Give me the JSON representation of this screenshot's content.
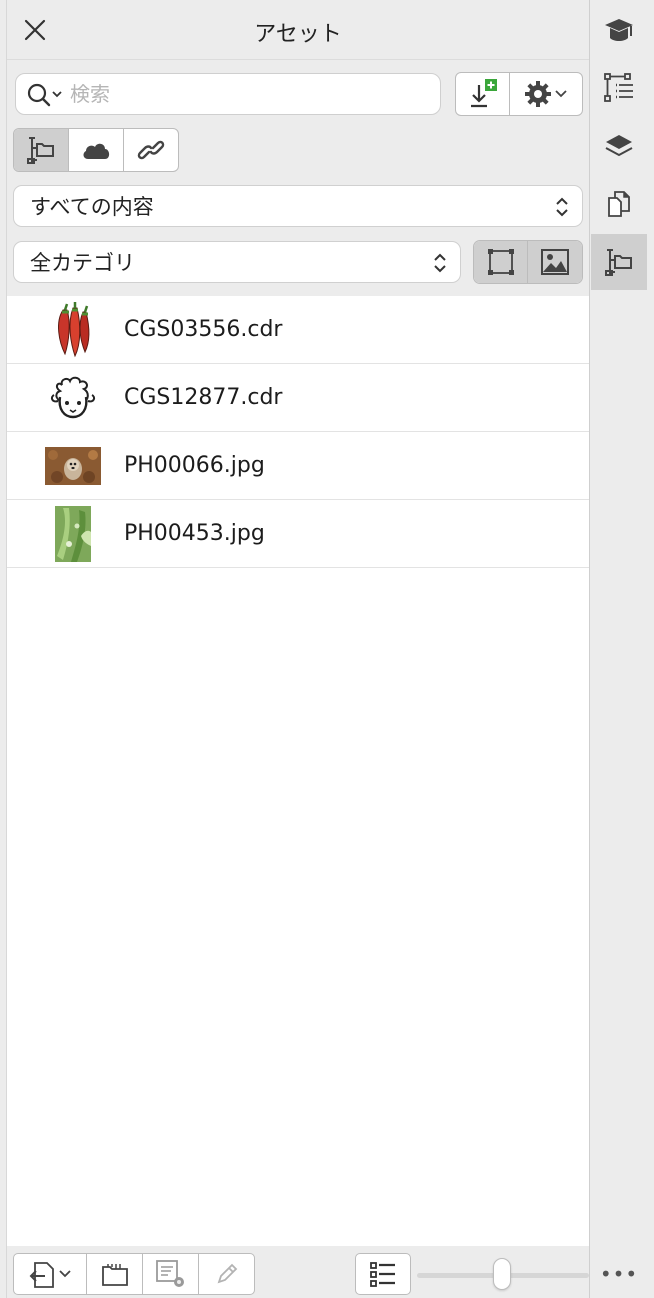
{
  "panel": {
    "title": "アセット",
    "search": {
      "placeholder": "検索",
      "value": ""
    },
    "source_tabs": [
      "folder-tree",
      "cloud",
      "link"
    ],
    "scope_dropdown": {
      "selected": "すべての内容"
    },
    "category_dropdown": {
      "selected": "全カテゴリ"
    },
    "files": [
      {
        "name": "CGS03556.cdr",
        "thumb": "chili-peppers"
      },
      {
        "name": "CGS12877.cdr",
        "thumb": "sheep"
      },
      {
        "name": "PH00066.jpg",
        "thumb": "dog-on-leaves"
      },
      {
        "name": "PH00453.jpg",
        "thumb": "green-plant"
      }
    ],
    "thumbnail_size_fraction": 0.52
  },
  "colors": {
    "panel_bg": "#ececec",
    "active_segment": "#cfcfcf",
    "add_green": "#3aa63a"
  }
}
